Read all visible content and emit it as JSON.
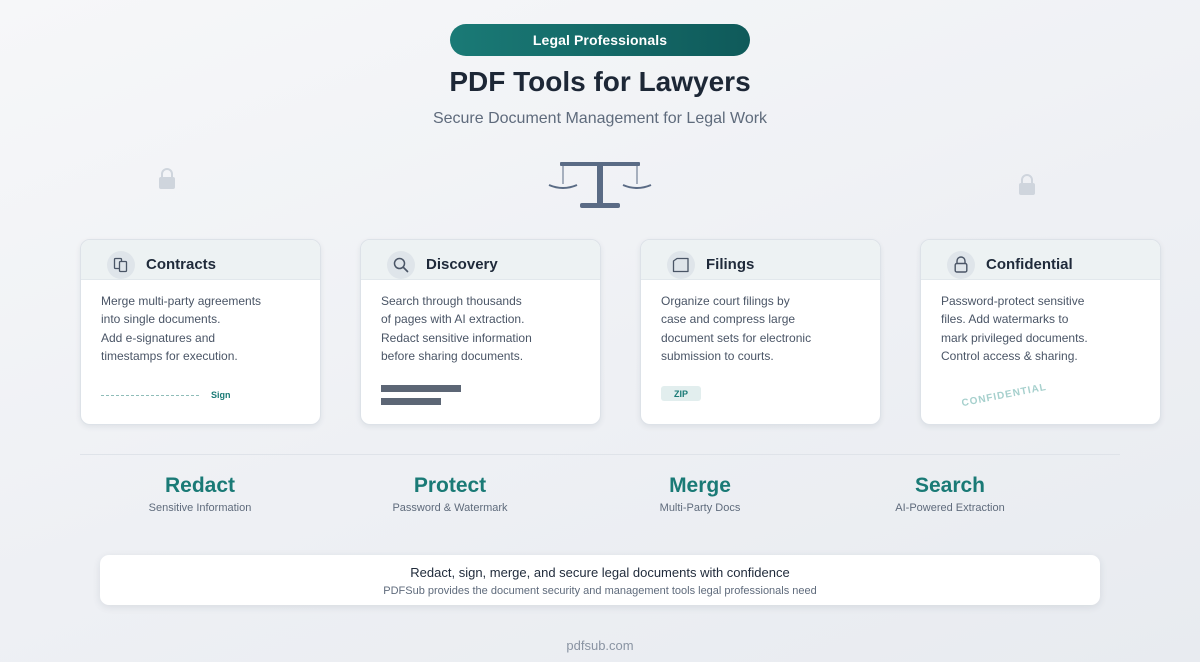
{
  "header": {
    "badge": "Legal Professionals",
    "title": "PDF Tools for Lawyers",
    "subtitle": "Secure Document Management for Legal Work"
  },
  "cards": [
    {
      "title": "Contracts",
      "icon": "documents-icon",
      "lines": [
        "Merge multi-party agreements",
        "into single documents.",
        "Add e-signatures and",
        "timestamps for execution."
      ],
      "extra_label": "Sign"
    },
    {
      "title": "Discovery",
      "icon": "search-icon",
      "lines": [
        "Search through thousands",
        "of pages with AI extraction.",
        "Redact sensitive information",
        "before sharing documents."
      ]
    },
    {
      "title": "Filings",
      "icon": "folder-icon",
      "lines": [
        "Organize court filings by",
        "case and compress large",
        "document sets for electronic",
        "submission to courts."
      ],
      "extra_label": "ZIP"
    },
    {
      "title": "Confidential",
      "icon": "lock-icon",
      "lines": [
        "Password-protect sensitive",
        "files. Add watermarks to",
        "mark privileged documents.",
        "Control access & sharing."
      ],
      "extra_label": "CONFIDENTIAL"
    }
  ],
  "features": [
    {
      "name": "Redact",
      "desc": "Sensitive Information"
    },
    {
      "name": "Protect",
      "desc": "Password & Watermark"
    },
    {
      "name": "Merge",
      "desc": "Multi-Party Docs"
    },
    {
      "name": "Search",
      "desc": "AI-Powered Extraction"
    }
  ],
  "cta": {
    "title": "Redact, sign, merge, and secure legal documents with confidence",
    "subtitle": "PDFSub provides the document security and management tools legal professionals need"
  },
  "footer": "pdfsub.com",
  "colors": {
    "accent": "#1a7a76",
    "text_dark": "#1f2a3a",
    "muted": "#5f6b7c"
  }
}
